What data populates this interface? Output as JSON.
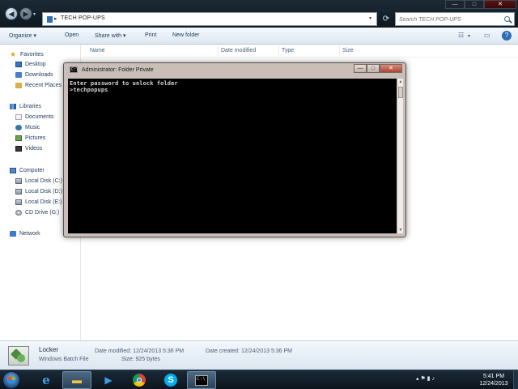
{
  "explorer": {
    "window_controls": {
      "minimize": "—",
      "maximize": "□",
      "close": "✕"
    },
    "address": {
      "folder_name": "TECH POP-UPS",
      "separator": "▸"
    },
    "search": {
      "placeholder": "Search TECH POP-UPS"
    },
    "toolbar": {
      "organize": "Organize ▾",
      "open": "Open",
      "share_with": "Share with ▾",
      "print": "Print",
      "new_folder": "New folder"
    },
    "nav_pane": {
      "favorites": "Favorites",
      "desktop": "Desktop",
      "downloads": "Downloads",
      "recent_places": "Recent Places",
      "libraries": "Libraries",
      "documents": "Documents",
      "music": "Music",
      "pictures": "Pictures",
      "videos": "Videos",
      "computer": "Computer",
      "local_disk_c": "Local Disk (C:)",
      "local_disk_d": "Local Disk (D:)",
      "local_disk_e": "Local Disk (E:)",
      "cd_drive": "CD Drive (G:)",
      "network": "Network"
    },
    "columns": {
      "name": "Name",
      "date_modified": "Date modified",
      "type": "Type",
      "size": "Size"
    },
    "details": {
      "file_name": "Locker",
      "file_type": "Windows Batch File",
      "date_modified_label": "Date modified: 12/24/2013 5:36 PM",
      "date_created_label": "Date created: 12/24/2013 5:36 PM",
      "size_label": "Size: 925 bytes"
    }
  },
  "cmd": {
    "title": "Administrator:  Folder Private",
    "icon_text": "C:\\",
    "line1": "Enter password to unlock folder",
    "line2": ">techpopups",
    "controls": {
      "minimize": "—",
      "maximize": "□",
      "close": "✕"
    }
  },
  "taskbar": {
    "clock_time": "5:41 PM",
    "clock_date": "12/24/2013",
    "tray_icons": "▴  ⚑  ▮  ♪"
  },
  "colors": {
    "taskbar": "#0c151d",
    "console_bg": "#000000",
    "console_text": "#d6d6d6",
    "explorer_toolbar": "#dde7f2"
  }
}
